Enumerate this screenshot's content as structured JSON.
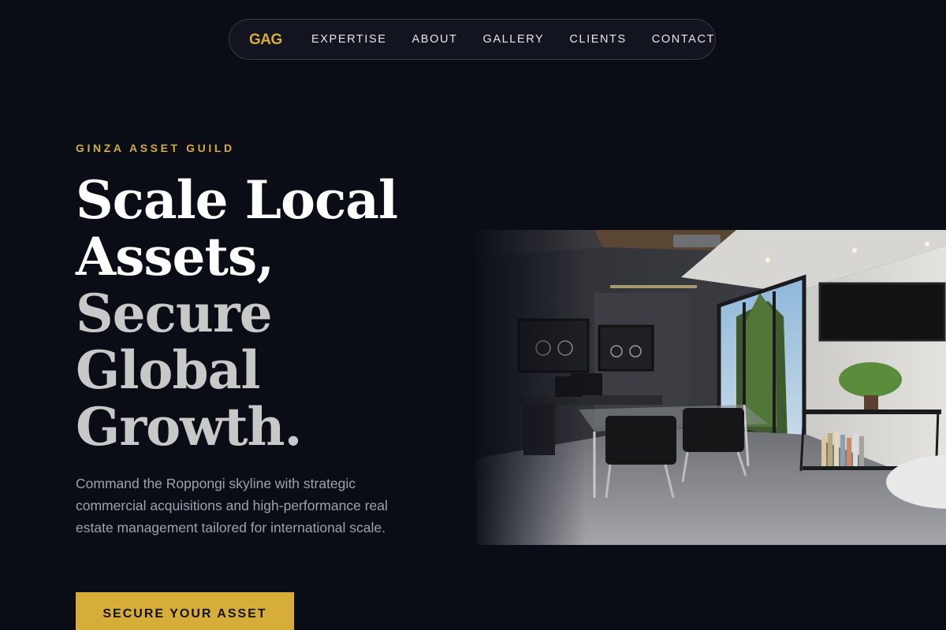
{
  "nav": {
    "brand": "GAG",
    "links": [
      "EXPERTISE",
      "ABOUT",
      "GALLERY",
      "CLIENTS",
      "CONTACT"
    ]
  },
  "hero": {
    "eyebrow": "GINZA ASSET GUILD",
    "headline_lines": [
      "Scale Local",
      "Assets,",
      "Secure",
      "Global",
      "Growth."
    ],
    "subtext": "Command the Roppongi skyline with strategic commercial acquisitions and high-performance real estate management tailored for international scale.",
    "cta_label": "SECURE YOUR ASSET",
    "image_alt": "Modern executive office interior"
  },
  "colors": {
    "background": "#0a0d16",
    "accent": "#d5ad38",
    "headline_primary": "#ffffff",
    "headline_secondary": "#c8c8c8",
    "body_text": "#9ea2ad"
  }
}
